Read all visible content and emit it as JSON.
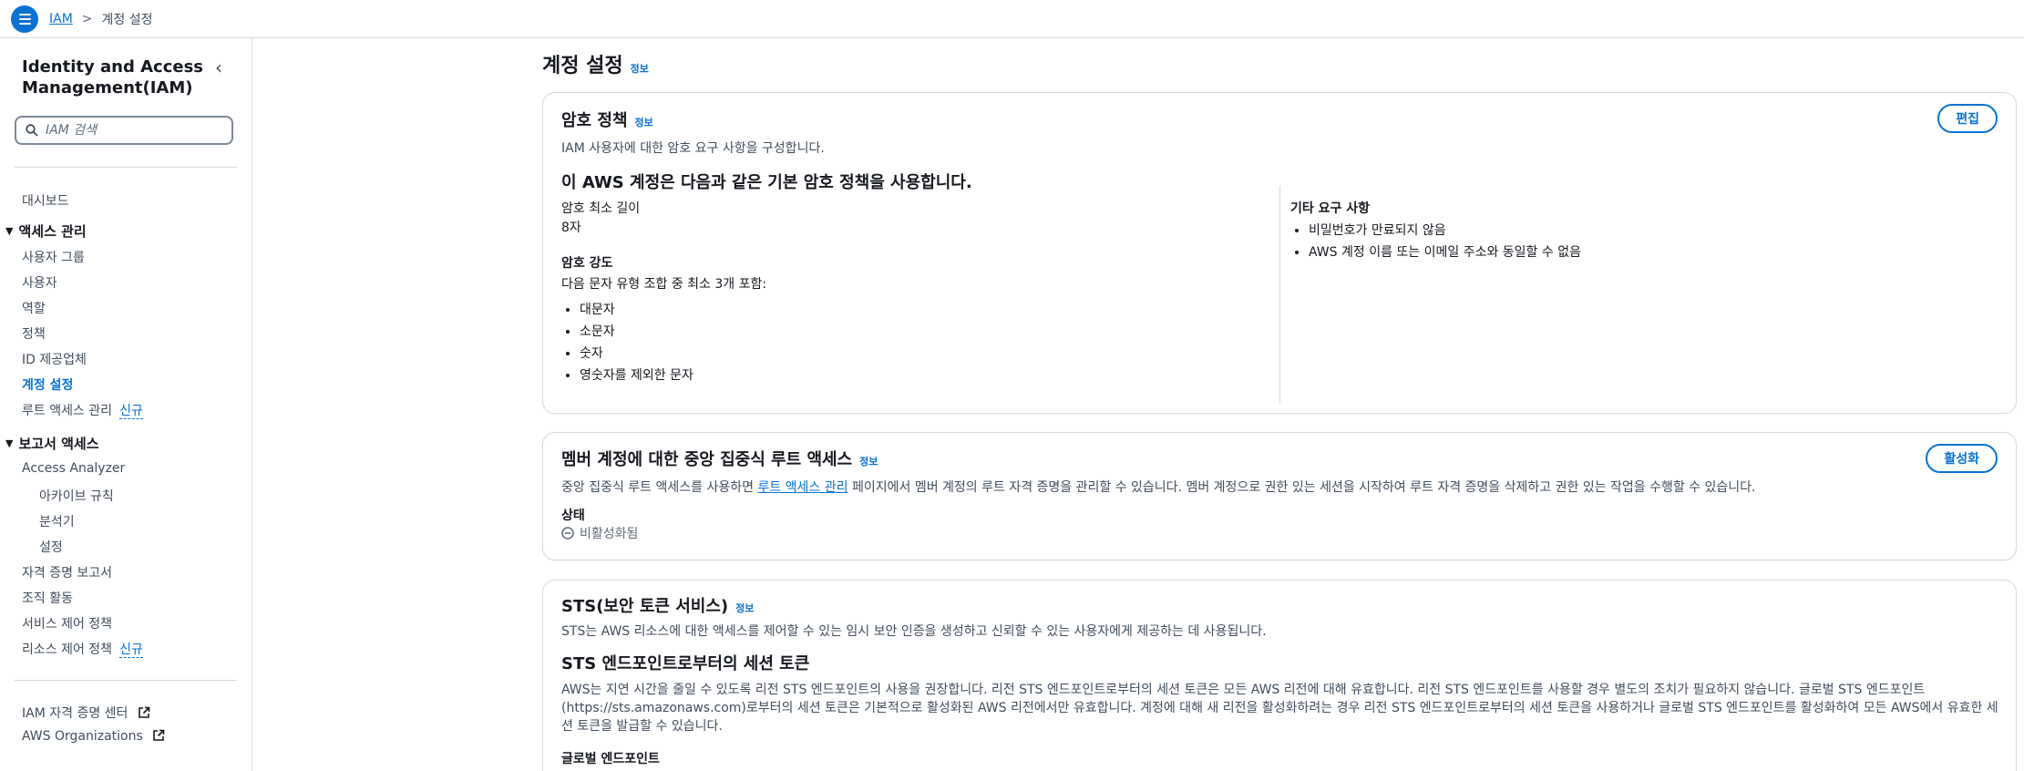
{
  "breadcrumb": {
    "root": "IAM",
    "current": "계정 설정"
  },
  "sidebar": {
    "title": "Identity and Access Management(IAM)",
    "search_placeholder": "IAM 검색",
    "dashboard": "대시보드",
    "access_group": "액세스 관리",
    "access_items": [
      "사용자 그룹",
      "사용자",
      "역할",
      "정책",
      "ID 제공업체",
      "계정 설정",
      "루트 액세스 관리"
    ],
    "new_badge": "신규",
    "report_group": "보고서 액세스",
    "analyzer": "Access Analyzer",
    "analyzer_items": [
      "아카이브 규칙",
      "분석기",
      "설정"
    ],
    "report_items": [
      "자격 증명 보고서",
      "조직 활동",
      "서비스 제어 정책",
      "리소스 제어 정책"
    ],
    "footer_links": [
      "IAM 자격 증명 센터",
      "AWS Organizations"
    ]
  },
  "page": {
    "title": "계정 설정",
    "info": "정보"
  },
  "password_policy": {
    "title": "암호 정책",
    "description": "IAM 사용자에 대한 암호 요구 사항을 구성합니다.",
    "edit_button": "편집",
    "subtitle": "이 AWS 계정은 다음과 같은 기본 암호 정책을 사용합니다.",
    "min_length_label": "암호 최소 길이",
    "min_length_value": "8자",
    "strength_label": "암호 강도",
    "strength_desc": "다음 문자 유형 조합 중 최소 3개 포함:",
    "strength_items": [
      "대문자",
      "소문자",
      "숫자",
      "영숫자를 제외한 문자"
    ],
    "other_label": "기타 요구 사항",
    "other_items": [
      "비밀번호가 만료되지 않음",
      "AWS 계정 이름 또는 이메일 주소와 동일할 수 없음"
    ]
  },
  "root_access": {
    "title": "멤버 계정에 대한 중앙 집중식 루트 액세스",
    "enable_button": "활성화",
    "desc_prefix": "중앙 집중식 루트 액세스를 사용하면 ",
    "desc_link": "루트 액세스 관리",
    "desc_suffix": " 페이지에서 멤버 계정의 루트 자격 증명을 관리할 수 있습니다. 멤버 계정으로 권한 있는 세션을 시작하여 루트 자격 증명을 삭제하고 권한 있는 작업을 수행할 수 있습니다.",
    "status_label": "상태",
    "status_value": "비활성화됨"
  },
  "sts": {
    "title": "STS(보안 토큰 서비스)",
    "description": "STS는 AWS 리소스에 대한 액세스를 제어할 수 있는 임시 보안 인증을 생성하고 신뢰할 수 있는 사용자에게 제공하는 데 사용됩니다.",
    "subtitle": "STS 엔드포인트로부터의 세션 토큰",
    "paragraph": "AWS는 지연 시간을 줄일 수 있도록 리전 STS 엔드포인트의 사용을 권장합니다. 리전 STS 엔드포인트로부터의 세션 토큰은 모든 AWS 리전에 대해 유효합니다. 리전 STS 엔드포인트를 사용할 경우 별도의 조치가 필요하지 않습니다. 글로벌 STS 엔드포인트(https://sts.amazonaws.com)로부터의 세션 토큰은 기본적으로 활성화된 AWS 리전에서만 유효합니다. 계정에 대해 새 리전을 활성화하려는 경우 리전 STS 엔드포인트로부터의 세션 토큰을 사용하거나 글로벌 STS 엔드포인트를 활성화하여 모든 AWS에서 유효한 세션 토큰을 발급할 수 있습니다.",
    "global_endpoint_label": "글로벌 엔드포인트"
  },
  "colors": {
    "accent": "#0972d3",
    "border": "#d5dbdb"
  }
}
